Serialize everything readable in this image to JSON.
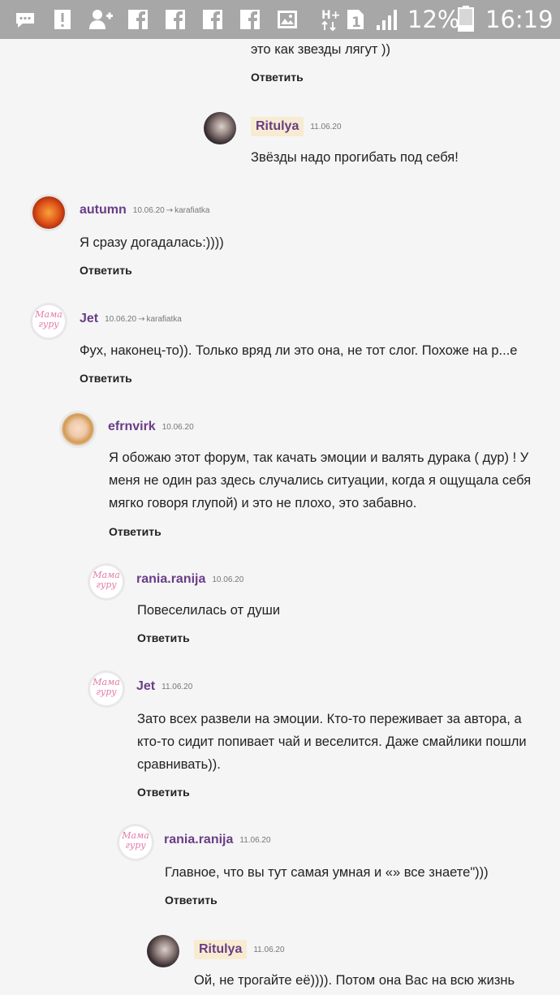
{
  "statusbar": {
    "icons": [
      "chat-icon",
      "alert-icon",
      "add-user-icon",
      "facebook-icon",
      "facebook-icon",
      "facebook-icon",
      "image-icon",
      "network-h-plus-icon",
      "sim-1-icon",
      "signal-icon",
      "battery-icon"
    ],
    "battery_pct": "12%",
    "time": "16:19"
  },
  "colors": {
    "author": "#6a3d86",
    "highlight": "#f7ecd1",
    "statusbar": "#a7a7a7"
  },
  "comments": [
    {
      "text": "это как звезды лягут ))",
      "reply": "Ответить"
    },
    {
      "author": "Ritulya",
      "date": "11.06.20",
      "text": "Звёзды надо прогибать под себя!"
    },
    {
      "author": "autumn",
      "date": "10.06.20",
      "arrow": "→",
      "target": "karafiatka",
      "text": "Я сразу догадалась:))))",
      "reply": "Ответить"
    },
    {
      "author": "Jet",
      "date": "10.06.20",
      "arrow": "→",
      "target": "karafiatka",
      "text": "Фух, наконец-то)). Только вряд ли это она, не тот слог. Похоже на р...е",
      "reply": "Ответить"
    },
    {
      "author": "efrnvirk",
      "date": "10.06.20",
      "text_lines": [
        "Я обожаю этот форум, так качать эмоции и валять дурака ( дур) ! У",
        "меня не один раз здесь случались ситуации, когда я ощущала себя",
        "мягко говоря глупой) и это не плохо, это забавно."
      ],
      "reply": "Ответить"
    },
    {
      "author": "rania.ranija",
      "date": "10.06.20",
      "text": "Повеселилась от души",
      "reply": "Ответить"
    },
    {
      "author": "Jet",
      "date": "11.06.20",
      "text_lines": [
        "Зато всех развели на эмоции. Кто-то переживает за автора, а",
        "кто-то сидит попивает чай и веселится. Даже смайлики пошли",
        "сравнивать))."
      ],
      "reply": "Ответить"
    },
    {
      "author": "rania.ranija",
      "date": "11.06.20",
      "text": "Главное, что вы тут самая умная и «» все знаете\")))",
      "reply": "Ответить"
    },
    {
      "author": "Ritulya",
      "date": "11.06.20",
      "text": "Ой, не трогайте её)))). Потом она Вас на всю жизнь"
    }
  ],
  "logo_text": "Мама гуру"
}
